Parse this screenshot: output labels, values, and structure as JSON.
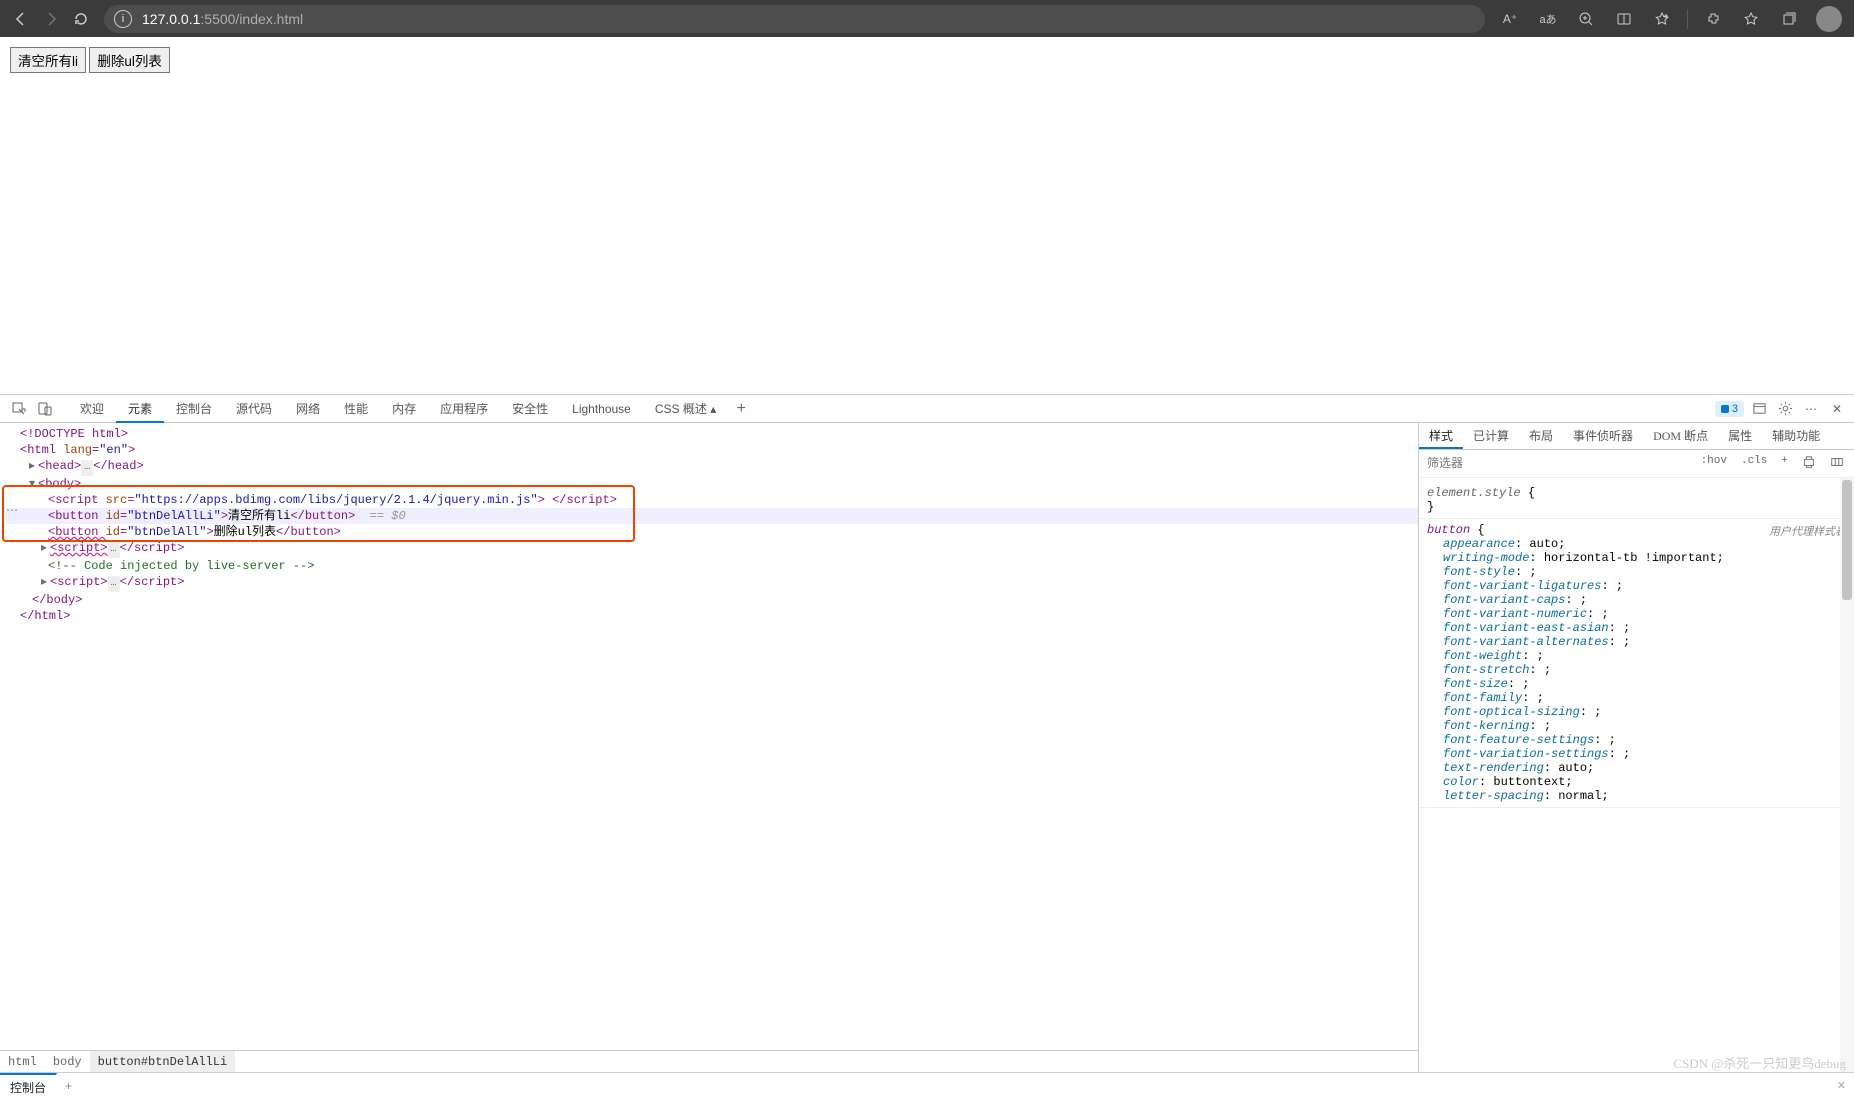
{
  "browser": {
    "url_host": "127.0.0.1",
    "url_port_path": ":5500/index.html",
    "read_aloud_label": "A⁺",
    "translate_label": "aあ"
  },
  "page": {
    "btn1": "清空所有li",
    "btn2": "删除ul列表"
  },
  "devtools": {
    "tabs": [
      "欢迎",
      "元素",
      "控制台",
      "源代码",
      "网络",
      "性能",
      "内存",
      "应用程序",
      "安全性",
      "Lighthouse",
      "CSS 概述 ▴"
    ],
    "active_tab": "元素",
    "issues_count": "3",
    "dom": {
      "l0": "<!DOCTYPE html>",
      "l1_open": "<html ",
      "l1_attr_n": "lang",
      "l1_attr_v": "\"en\"",
      "l1_close_gt": ">",
      "head_open": "<head>",
      "head_ell": "…",
      "head_close": "</head>",
      "body_open": "<body>",
      "script1_pre": "<script ",
      "script1_an": "src",
      "script1_av": "\"https://apps.bdimg.com/libs/jquery/2.1.4/jquery.min.js\"",
      "script1_mid": "> ",
      "script1_close": "</script>",
      "btn1_pre": "<button ",
      "btn1_an": "id",
      "btn1_av": "\"btnDelAllLi\"",
      "btn1_gt": ">",
      "btn1_txt": "清空所有li",
      "btn1_close": "</button>",
      "eq_dollar": "  == $0",
      "btn2_pre": "<button ",
      "btn2_an": "id",
      "btn2_av": "\"btnDelAll\"",
      "btn2_gt": ">",
      "btn2_txt": "删除ul列表",
      "btn2_close": "</button>",
      "script2_open": "<script>",
      "script2_ell": "…",
      "script2_close": "</script>",
      "comment": "<!-- Code injected by live-server -->",
      "script3_open": "<script>",
      "script3_ell": "…",
      "script3_close": "</script>",
      "body_close": "</body>",
      "html_close": "</html>"
    },
    "breadcrumb": [
      "html",
      "body",
      "button#btnDelAllLi"
    ],
    "styles_tabs": [
      "样式",
      "已计算",
      "布局",
      "事件侦听器",
      "DOM 断点",
      "属性",
      "辅助功能"
    ],
    "filter_placeholder": "筛选器",
    "hov": ":hov",
    "cls": ".cls",
    "rule0_selector": "element.style",
    "rule0_open": " {",
    "rule0_close": "}",
    "rule1_selector": "button",
    "rule1_open": " {",
    "rule1_origin": "用户代理样式表",
    "props": [
      {
        "n": "appearance",
        "v": "auto;"
      },
      {
        "n": "writing-mode",
        "v": "horizontal-tb !important;"
      },
      {
        "n": "font-style",
        "v": ";"
      },
      {
        "n": "font-variant-ligatures",
        "v": ";"
      },
      {
        "n": "font-variant-caps",
        "v": ";"
      },
      {
        "n": "font-variant-numeric",
        "v": ";"
      },
      {
        "n": "font-variant-east-asian",
        "v": ";"
      },
      {
        "n": "font-variant-alternates",
        "v": ";"
      },
      {
        "n": "font-weight",
        "v": ";"
      },
      {
        "n": "font-stretch",
        "v": ";"
      },
      {
        "n": "font-size",
        "v": ";"
      },
      {
        "n": "font-family",
        "v": ";"
      },
      {
        "n": "font-optical-sizing",
        "v": ";"
      },
      {
        "n": "font-kerning",
        "v": ";"
      },
      {
        "n": "font-feature-settings",
        "v": ";"
      },
      {
        "n": "font-variation-settings",
        "v": ";"
      },
      {
        "n": "text-rendering",
        "v": "auto;"
      },
      {
        "n": "color",
        "v": "buttontext;"
      },
      {
        "n": "letter-spacing",
        "v": "normal;"
      }
    ],
    "drawer_tab": "控制台"
  },
  "watermark": "CSDN @杀死一只知更鸟debug"
}
